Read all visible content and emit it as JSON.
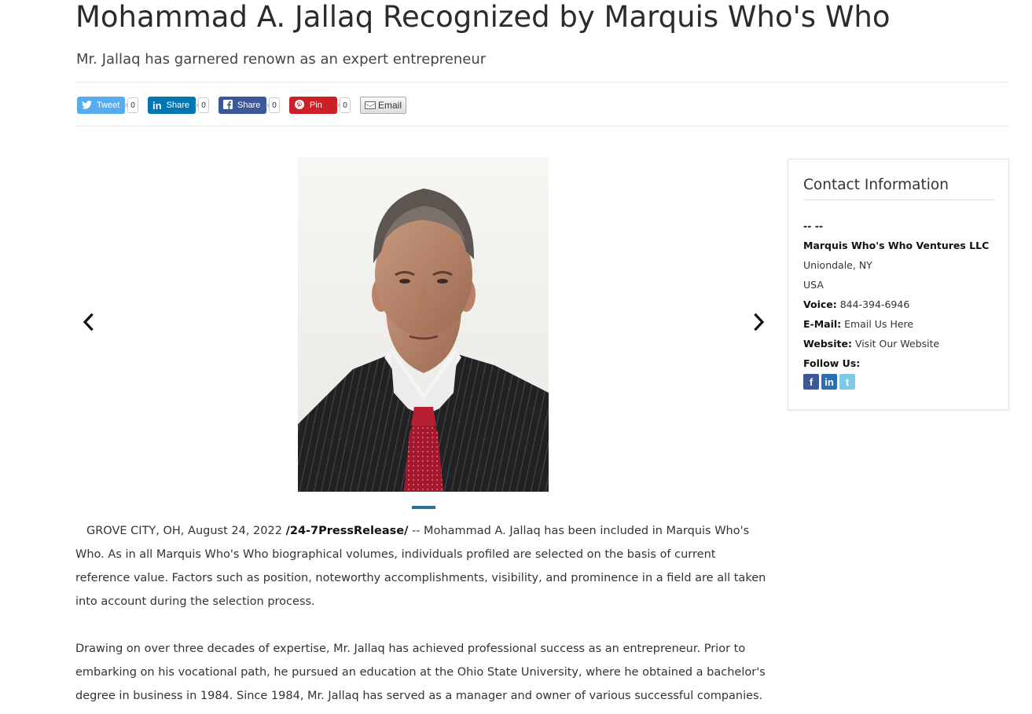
{
  "article": {
    "headline": "Mohammad A. Jallaq Recognized by Marquis Who's Who",
    "subheadline": "Mr. Jallaq has garnered renown as an expert entrepreneur",
    "paragraphs": [
      {
        "dateline": "GROVE CITY, OH, August 24, 2022",
        "source": "/24-7PressRelease/",
        "text": " -- Mohammad A. Jallaq has been included in Marquis Who's Who. As in all Marquis Who's Who biographical volumes, individuals profiled are selected on the basis of current reference value. Factors such as position, noteworthy accomplishments, visibility, and prominence in a field are all taken into account during the selection process."
      },
      {
        "text": "Drawing on over three decades of expertise, Mr. Jallaq has achieved professional success as an entrepreneur. Prior to embarking on his vocational path, he pursued an education at the Ohio State University, where he obtained a bachelor's degree in business in 1984. Since 1984, Mr. Jallaq has served as a manager and owner of various successful companies."
      }
    ]
  },
  "share": {
    "tweet_label": "Tweet",
    "tweet_count": "0",
    "linkedin_label": "Share",
    "linkedin_count": "0",
    "facebook_label": "Share",
    "facebook_count": "0",
    "pinterest_label": "Pin",
    "pinterest_count": "0",
    "email_label": "Email",
    "colors": {
      "twitter": "#55acee",
      "linkedin": "#0077b5",
      "facebook": "#3b5998",
      "pinterest": "#cb2027"
    }
  },
  "carousel": {
    "prev_icon": "chevron-left-icon",
    "next_icon": "chevron-right-icon",
    "indicator_color": "#2a6f97"
  },
  "contact": {
    "title": "Contact Information",
    "name": "-- --",
    "company": "Marquis Who's Who Ventures LLC",
    "city": "Uniondale, NY",
    "country": "USA",
    "voice_label": "Voice:",
    "voice_value": "844-394-6946",
    "email_label": "E-Mail:",
    "email_value": "Email Us Here",
    "website_label": "Website:",
    "website_value": "Visit Our Website",
    "follow_label": "Follow Us:",
    "social_icons": [
      "facebook-icon",
      "linkedin-icon",
      "twitter-icon"
    ]
  }
}
